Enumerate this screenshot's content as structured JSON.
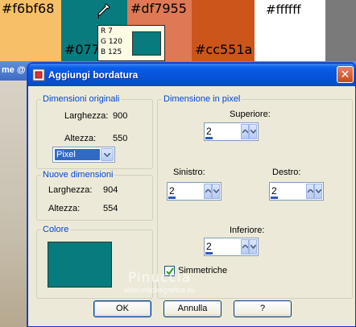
{
  "swatches": [
    {
      "label": "#f6bf68",
      "color": "#f6bf68"
    },
    {
      "label": "#077",
      "color": "#077b7d"
    },
    {
      "label": "#df7955",
      "color": "#df7955"
    },
    {
      "label": "#cc551a",
      "color": "#cc551a"
    },
    {
      "label": "#ffffff",
      "color": "#ffffff"
    },
    {
      "label": "",
      "color": "#7a7a7a"
    }
  ],
  "color_tooltip": {
    "r": "R 7",
    "g": "G 120",
    "b": "B 125",
    "color": "#077b7d"
  },
  "bg_window": {
    "title_fragment": "me @"
  },
  "dialog": {
    "title": "Aggiungi bordatura",
    "close_glyph": "✕",
    "original": {
      "group_label": "Dimensioni originali",
      "width_label": "Larghezza:",
      "width_value": "900",
      "height_label": "Altezza:",
      "height_value": "550",
      "unit": "Pixel"
    },
    "new": {
      "group_label": "Nuove dimensioni",
      "width_label": "Larghezza:",
      "width_value": "904",
      "height_label": "Altezza:",
      "height_value": "554"
    },
    "color": {
      "group_label": "Colore",
      "value": "#077b7d"
    },
    "pixels": {
      "group_label": "Dimensione in pixel",
      "top_label": "Superiore:",
      "top_value": "2",
      "left_label": "Sinistro:",
      "left_value": "2",
      "right_label": "Destro:",
      "right_value": "2",
      "bottom_label": "Inferiore:",
      "bottom_value": "2",
      "symmetric_label": "Simmetriche",
      "symmetric_checked": true
    },
    "buttons": {
      "ok": "OK",
      "cancel": "Annulla",
      "help": "?"
    }
  },
  "watermark": {
    "line1": "Pinuccia",
    "line2": "www.madiregrafica.eu"
  }
}
